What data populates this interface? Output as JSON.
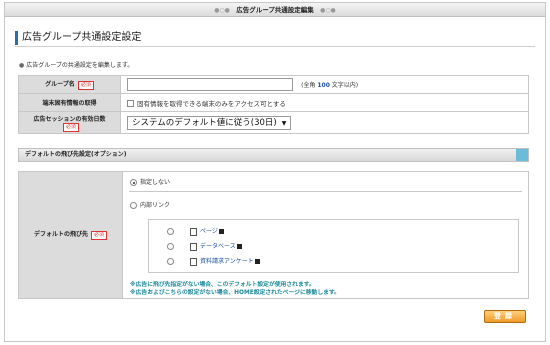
{
  "window": {
    "title": "広告グループ共通設定編集"
  },
  "heading": "広告グループ共通設定設定",
  "description": "広告グループの共通設定を編集します。",
  "form": {
    "group_name": {
      "label": "グループ名",
      "required": "必須",
      "value": "",
      "hint_prefix": "(全角",
      "hint_num": "100",
      "hint_suffix": "文字以内)"
    },
    "device": {
      "label": "端末固有情報の取得",
      "checkbox_label": "固有情報を取得できる端末のみをアクセス可とする"
    },
    "session": {
      "label": "広告セッションの有効日数",
      "required": "必須",
      "selected": "システムのデフォルト値に従う(30日)"
    }
  },
  "section": {
    "title": "デフォルトの飛び先設定(オプション)"
  },
  "destination": {
    "label": "デフォルトの飛び先",
    "required": "必須",
    "option_none": "指定しない",
    "option_internal": "内部リンク",
    "links": [
      "ページ",
      "データベース",
      "資料請求アンケート"
    ],
    "note1": "※広告に飛び先指定がない場合、このデフォルト設定が使用されます。",
    "note2": "※広告およびこちらの設定がない場合、HOME設定されたページに移動します。"
  },
  "submit_label": "登録",
  "colors": {
    "accent": "#2a6fa8",
    "required": "#dd3333",
    "link": "#1a4fa0",
    "note": "#1a8a9a",
    "button": "#f09a2a"
  }
}
